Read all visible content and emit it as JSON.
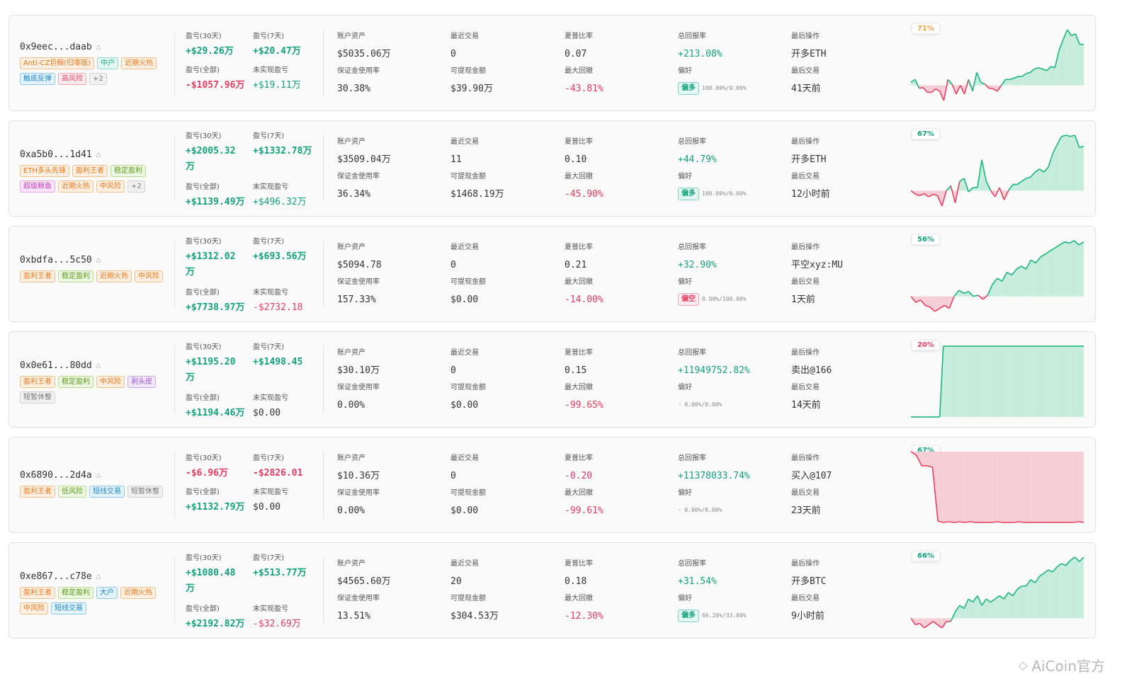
{
  "labels": {
    "pnl30": "盈亏(30天)",
    "pnl7": "盈亏(7天)",
    "pnlAll": "盈亏(全部)",
    "unrealized": "未实现盈亏",
    "assets": "账户资产",
    "recentTrades": "最近交易",
    "sharpe": "夏普比率",
    "totalReturn": "总回报率",
    "lastAction": "最后操作",
    "marginUsage": "保证金使用率",
    "withdrawable": "可提现金额",
    "maxDrawdown": "最大回撤",
    "preference": "偏好",
    "lastTrade": "最后交易"
  },
  "watermark": "AiCoin官方",
  "rows": [
    {
      "address": "0x9eec...daab",
      "tags": [
        {
          "text": "Anti-CZ巨鲸(归零版)",
          "color": "orange"
        },
        {
          "text": "中户",
          "color": "teal"
        },
        {
          "text": "近期火热",
          "color": "orange"
        },
        {
          "text": "触底反弹",
          "color": "blue"
        },
        {
          "text": "高风险",
          "color": "red"
        },
        {
          "text": "+2",
          "color": "gray"
        }
      ],
      "pnl30": "+$29.26万",
      "pnl7": "+$20.47万",
      "pnlAll": "-$1057.96万",
      "unrealized": "+$19.11万",
      "assets": "$5035.06万",
      "recentTrades": "0",
      "sharpe": "0.07",
      "totalReturn": "+213.08%",
      "lastAction": "开多ETH",
      "marginUsage": "30.38%",
      "withdrawable": "$39.90万",
      "maxDrawdown": "-43.81%",
      "bias": {
        "label": "偏多",
        "type": "long",
        "ratio": "100.00%/0.00%"
      },
      "lastTrade": "41天前",
      "winrate": "71%",
      "winrateColor": "#f0a23a",
      "chart": [
        0.05,
        0.1,
        -0.05,
        -0.04,
        -0.12,
        -0.12,
        -0.06,
        -0.1,
        -0.26,
        0.1,
        0.02,
        -0.15,
        0.0,
        -0.15,
        0.1,
        -0.1,
        0.22,
        0.05,
        0.02,
        -0.05,
        -0.06,
        -0.1,
        0.0,
        0.1,
        0.1,
        0.12,
        0.15,
        0.15,
        0.2,
        0.22,
        0.28,
        0.3,
        0.28,
        0.25,
        0.32,
        0.3,
        0.6,
        0.78,
        0.95,
        0.85,
        0.88,
        0.7,
        0.7
      ]
    },
    {
      "address": "0xa5b0...1d41",
      "tags": [
        {
          "text": "ETH多头先锋",
          "color": "orange"
        },
        {
          "text": "盈利王者",
          "color": "orange"
        },
        {
          "text": "稳定盈利",
          "color": "green"
        },
        {
          "text": "超级鲸鱼",
          "color": "pink"
        },
        {
          "text": "近期火热",
          "color": "orange"
        },
        {
          "text": "中风险",
          "color": "orange"
        },
        {
          "text": "+2",
          "color": "gray"
        }
      ],
      "pnl30": "+$2005.32万",
      "pnl7": "+$1332.78万",
      "pnlAll": "+$1139.49万",
      "unrealized": "+$496.32万",
      "assets": "$3509.04万",
      "recentTrades": "11",
      "sharpe": "0.10",
      "totalReturn": "+44.79%",
      "lastAction": "开多ETH",
      "marginUsage": "36.34%",
      "withdrawable": "$1468.19万",
      "maxDrawdown": "-45.90%",
      "bias": {
        "label": "偏多",
        "type": "long",
        "ratio": "100.00%/0.00%"
      },
      "lastTrade": "12小时前",
      "winrate": "67%",
      "winrateColor": "#10a37a",
      "chart": [
        0.0,
        -0.06,
        -0.08,
        -0.05,
        -0.1,
        -0.06,
        -0.08,
        -0.25,
        0.0,
        0.08,
        -0.2,
        0.15,
        0.2,
        -0.02,
        0.05,
        0.05,
        0.5,
        0.15,
        0.0,
        -0.1,
        0.05,
        -0.15,
        0.0,
        0.1,
        0.1,
        0.15,
        0.2,
        0.22,
        0.3,
        0.35,
        0.3,
        0.38,
        0.6,
        0.75,
        0.88,
        0.9,
        0.88,
        0.9,
        0.7,
        0.72
      ]
    },
    {
      "address": "0xbdfa...5c50",
      "tags": [
        {
          "text": "盈利王者",
          "color": "orange"
        },
        {
          "text": "稳定盈利",
          "color": "green"
        },
        {
          "text": "近期火热",
          "color": "orange"
        },
        {
          "text": "中风险",
          "color": "orange"
        }
      ],
      "pnl30": "+$1312.02万",
      "pnl7": "+$693.56万",
      "pnlAll": "+$7738.97万",
      "unrealized": "-$2732.18",
      "assets": "$5094.78",
      "recentTrades": "0",
      "sharpe": "0.21",
      "totalReturn": "+32.90%",
      "lastAction": "平空xyz:MU",
      "marginUsage": "157.33%",
      "withdrawable": "$0.00",
      "maxDrawdown": "-14.00%",
      "bias": {
        "label": "偏空",
        "type": "short",
        "ratio": "0.00%/100.00%"
      },
      "lastTrade": "1天前",
      "winrate": "56%",
      "winrateColor": "#10a37a",
      "chart": [
        0.0,
        -0.1,
        -0.06,
        -0.15,
        -0.18,
        -0.25,
        -0.2,
        -0.15,
        -0.2,
        0.0,
        0.1,
        0.05,
        0.08,
        0.0,
        0.02,
        -0.05,
        0.02,
        0.2,
        0.3,
        0.25,
        0.4,
        0.35,
        0.45,
        0.5,
        0.45,
        0.6,
        0.55,
        0.65,
        0.7,
        0.75,
        0.8,
        0.85,
        0.9,
        0.88,
        0.92,
        0.85,
        0.9
      ]
    },
    {
      "address": "0x0e61...80dd",
      "tags": [
        {
          "text": "盈利王者",
          "color": "orange"
        },
        {
          "text": "稳定盈利",
          "color": "green"
        },
        {
          "text": "中风险",
          "color": "orange"
        },
        {
          "text": "剥头皮",
          "color": "purple"
        },
        {
          "text": "短暂休整",
          "color": "gray"
        }
      ],
      "pnl30": "+$1195.20万",
      "pnl7": "+$1498.45",
      "pnlAll": "+$1194.46万",
      "unrealized": "$0.00",
      "assets": "$30.10万",
      "recentTrades": "0",
      "sharpe": "0.15",
      "totalReturn": "+11949752.82%",
      "lastAction": "卖出@166",
      "marginUsage": "0.00%",
      "withdrawable": "$0.00",
      "maxDrawdown": "-99.65%",
      "bias": {
        "label": "-",
        "type": "none",
        "ratio": "0.00%/0.00%"
      },
      "lastTrade": "14天前",
      "winrate": "20%",
      "winrateColor": "#e83a5f",
      "chart": [
        0.0,
        0.0,
        0.0,
        0.0,
        0.0,
        0.0,
        0.0,
        0.0,
        0.0,
        1.0,
        1.0,
        1.0,
        1.0,
        1.0,
        1.0,
        1.0,
        1.0,
        1.0,
        1.0,
        1.0,
        1.0,
        1.0,
        1.0,
        1.0,
        1.0,
        1.0,
        1.0,
        1.0,
        1.0,
        1.0,
        1.0,
        1.0,
        1.0,
        1.0,
        1.0,
        1.0,
        1.0,
        1.0,
        1.0,
        1.0,
        1.0,
        1.0,
        1.0,
        1.0,
        1.0,
        1.0,
        1.0,
        1.0,
        1.0
      ]
    },
    {
      "address": "0x6890...2d4a",
      "tags": [
        {
          "text": "盈利王者",
          "color": "orange"
        },
        {
          "text": "低风险",
          "color": "green"
        },
        {
          "text": "短线交易",
          "color": "blue"
        },
        {
          "text": "短暂休整",
          "color": "gray"
        }
      ],
      "pnl30": "-$6.96万",
      "pnl7": "-$2826.01",
      "pnlAll": "+$1132.79万",
      "unrealized": "$0.00",
      "assets": "$10.36万",
      "recentTrades": "0",
      "sharpe": "-0.20",
      "totalReturn": "+11378033.74%",
      "lastAction": "买入@107",
      "marginUsage": "0.00%",
      "withdrawable": "$0.00",
      "maxDrawdown": "-99.61%",
      "bias": {
        "label": "-",
        "type": "none",
        "ratio": "0.00%/0.00%"
      },
      "lastTrade": "23天前",
      "winrate": "67%",
      "winrateColor": "#10a37a",
      "chart": [
        0.0,
        -0.05,
        -0.2,
        -0.2,
        -0.22,
        -0.98,
        -1.0,
        -0.99,
        -1.0,
        -0.99,
        -1.0,
        -0.99,
        -1.0,
        -1.0,
        -1.0,
        -1.0,
        -0.99,
        -1.0,
        -1.0,
        -1.0,
        -0.99,
        -1.0,
        -1.0,
        -1.0,
        -1.0,
        -1.0,
        -1.0,
        -1.0,
        -1.0,
        -1.0,
        -1.0,
        -0.99,
        -1.0
      ]
    },
    {
      "address": "0xe867...c78e",
      "tags": [
        {
          "text": "盈利王者",
          "color": "orange"
        },
        {
          "text": "稳定盈利",
          "color": "green"
        },
        {
          "text": "大户",
          "color": "blue"
        },
        {
          "text": "近期火热",
          "color": "orange"
        },
        {
          "text": "中风险",
          "color": "orange"
        },
        {
          "text": "短线交易",
          "color": "blue"
        }
      ],
      "pnl30": "+$1080.48万",
      "pnl7": "+$513.77万",
      "pnlAll": "+$2192.82万",
      "unrealized": "-$32.69万",
      "assets": "$4565.60万",
      "recentTrades": "20",
      "sharpe": "0.18",
      "totalReturn": "+31.54%",
      "lastAction": "开多BTC",
      "marginUsage": "13.51%",
      "withdrawable": "$304.53万",
      "maxDrawdown": "-12.30%",
      "bias": {
        "label": "偏多",
        "type": "long",
        "ratio": "66.20%/33.80%"
      },
      "lastTrade": "9小时前",
      "winrate": "66%",
      "winrateColor": "#10a37a",
      "chart": [
        0.0,
        -0.1,
        -0.08,
        -0.15,
        -0.1,
        -0.05,
        -0.1,
        -0.15,
        -0.05,
        -0.05,
        0.1,
        0.2,
        0.15,
        0.3,
        0.25,
        0.35,
        0.2,
        0.3,
        0.25,
        0.3,
        0.35,
        0.3,
        0.4,
        0.35,
        0.45,
        0.5,
        0.5,
        0.6,
        0.55,
        0.65,
        0.7,
        0.75,
        0.72,
        0.8,
        0.85,
        0.82,
        0.9,
        0.95,
        0.88,
        0.95
      ]
    }
  ]
}
